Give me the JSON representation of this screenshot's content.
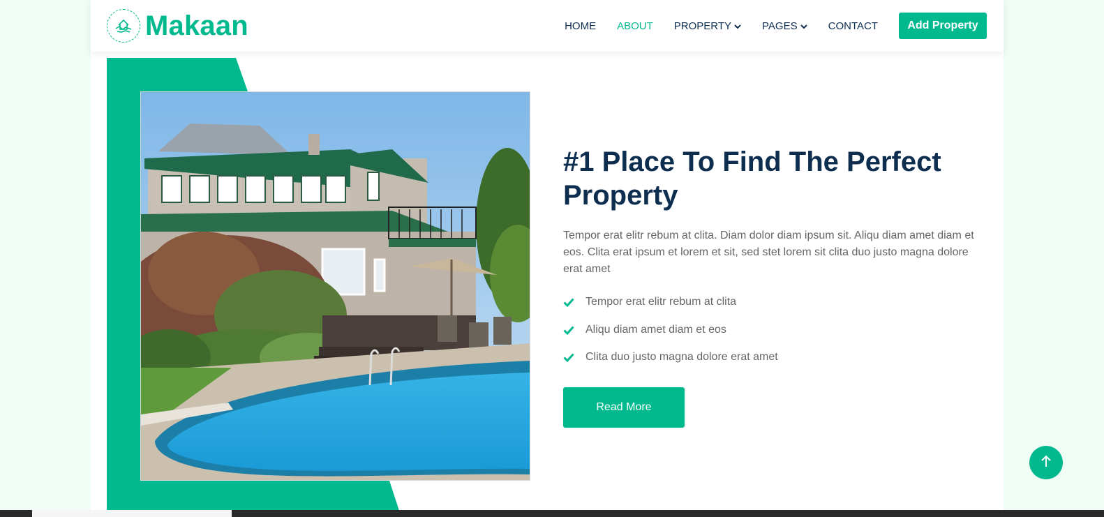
{
  "brand": {
    "name": "Makaan",
    "icon": "handshake-house-icon"
  },
  "nav": {
    "items": [
      {
        "label": "HOME",
        "active": false
      },
      {
        "label": "ABOUT",
        "active": true
      },
      {
        "label": "PROPERTY",
        "has_dropdown": true
      },
      {
        "label": "PAGES",
        "has_dropdown": true
      },
      {
        "label": "CONTACT",
        "active": false
      }
    ],
    "cta_label": "Add Property"
  },
  "about": {
    "heading": "#1 Place To Find The Perfect Property",
    "paragraph": "Tempor erat elitr rebum at clita. Diam dolor diam ipsum sit. Aliqu diam amet diam et eos. Clita erat ipsum et lorem et sit, sed stet lorem sit clita duo justo magna dolore erat amet",
    "checks": [
      "Tempor erat elitr rebum at clita",
      "Aliqu diam amet diam et eos",
      "Clita duo justo magna dolore erat amet"
    ],
    "button_label": "Read More",
    "image_subject": "house with pool"
  },
  "colors": {
    "primary": "#00b98e",
    "dark": "#0e2e50",
    "body_text": "#666565",
    "page_bg": "#effdf5"
  }
}
